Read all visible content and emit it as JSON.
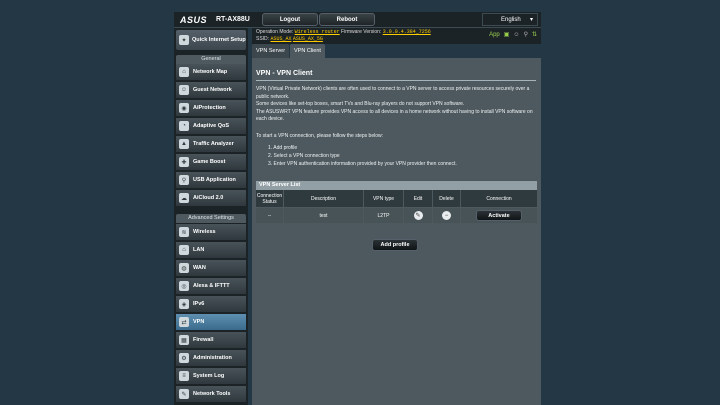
{
  "header": {
    "logo": "ASUS",
    "model": "RT-AX88U",
    "logout_label": "Logout",
    "reboot_label": "Reboot",
    "language": "English"
  },
  "info": {
    "op_mode_label": "Operation Mode:",
    "op_mode_value": "Wireless router",
    "firmware_label": "Firmware Version:",
    "firmware_value": "3.0.0.4.384_7256",
    "ssid_label": "SSID:",
    "ssid_1": "ASUS_AX",
    "ssid_2": "ASUS_AX_5G",
    "app_label": "App"
  },
  "sidebar": {
    "qis_label": "Quick Internet Setup",
    "general_header": "General",
    "general_items": [
      {
        "label": "Network Map",
        "icon": "network-map-icon",
        "glyph": "⌂"
      },
      {
        "label": "Guest Network",
        "icon": "guest-network-icon",
        "glyph": "☺"
      },
      {
        "label": "AiProtection",
        "icon": "shield-icon",
        "glyph": "◉"
      },
      {
        "label": "Adaptive QoS",
        "icon": "qos-icon",
        "glyph": "◔"
      },
      {
        "label": "Traffic Analyzer",
        "icon": "traffic-analyzer-icon",
        "glyph": "▲"
      },
      {
        "label": "Game Boost",
        "icon": "gamepad-icon",
        "glyph": "✚"
      },
      {
        "label": "USB Application",
        "icon": "usb-icon",
        "glyph": "⚲"
      },
      {
        "label": "AiCloud 2.0",
        "icon": "cloud-icon",
        "glyph": "☁"
      }
    ],
    "advanced_header": "Advanced Settings",
    "advanced_items": [
      {
        "label": "Wireless",
        "icon": "wireless-icon",
        "glyph": "≋"
      },
      {
        "label": "LAN",
        "icon": "lan-icon",
        "glyph": "⌂"
      },
      {
        "label": "WAN",
        "icon": "globe-icon",
        "glyph": "◍"
      },
      {
        "label": "Alexa & IFTTT",
        "icon": "alexa-icon",
        "glyph": "◎"
      },
      {
        "label": "IPv6",
        "icon": "ipv6-icon",
        "glyph": "◈"
      },
      {
        "label": "VPN",
        "icon": "vpn-icon",
        "glyph": "⇄"
      },
      {
        "label": "Firewall",
        "icon": "firewall-icon",
        "glyph": "▦"
      },
      {
        "label": "Administration",
        "icon": "administration-icon",
        "glyph": "⚙"
      },
      {
        "label": "System Log",
        "icon": "system-log-icon",
        "glyph": "≡"
      },
      {
        "label": "Network Tools",
        "icon": "network-tools-icon",
        "glyph": "✎"
      }
    ],
    "active": "VPN"
  },
  "tabs": [
    {
      "label": "VPN Server"
    },
    {
      "label": "VPN Client"
    }
  ],
  "main": {
    "title": "VPN - VPN Client",
    "desc_1": "VPN (Virtual Private Network) clients are often used to connect to a VPN server to access private resources securely over a public network.",
    "desc_2": "Some devices like set-top boxes, smart TVs and Blu-ray players do not support VPN software.",
    "desc_3": "The ASUSWRT VPN feature provides VPN access to all devices in a home network without having to install VPN software on each device.",
    "steps_intro": "To start a VPN connection, please follow the steps below:",
    "steps": [
      "1. Add profile",
      "2. Select a VPN connection type",
      "3. Enter VPN authentication information provided by your VPN provider then connect."
    ]
  },
  "table": {
    "title": "VPN Server List",
    "headers": [
      "Connection Status",
      "Description",
      "VPN type",
      "Edit",
      "Delete",
      "Connection"
    ],
    "rows": [
      {
        "status": "--",
        "description": "test",
        "type": "L2TP",
        "connection": "Activate"
      }
    ]
  },
  "add_profile_label": "Add profile",
  "colors": {
    "background": "#243744",
    "panel": "#4d595f",
    "active_nav": "#5e8fb0",
    "status_green": "#9bd04f",
    "firmware_yellow": "#ffcc00"
  }
}
